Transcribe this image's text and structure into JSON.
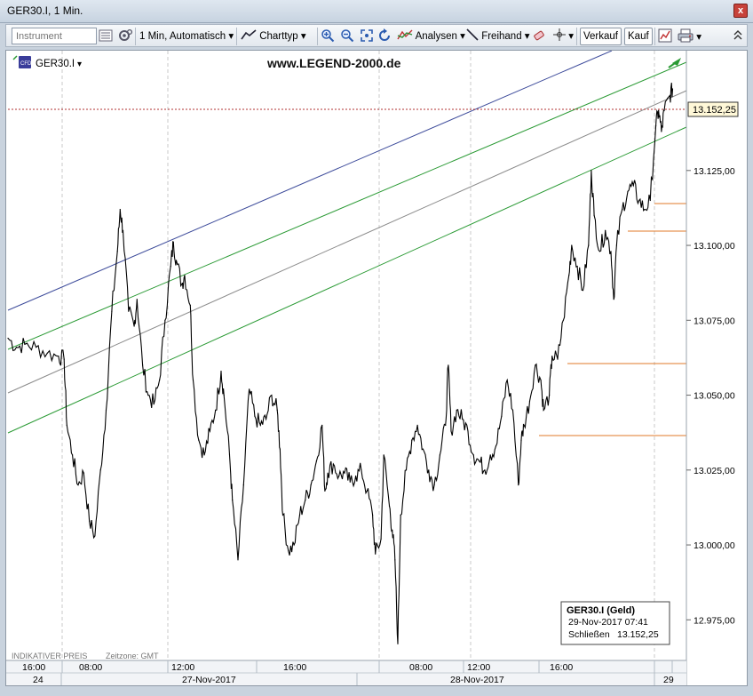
{
  "window": {
    "title": "GER30.I, 1 Min.",
    "close_label": "x"
  },
  "toolbar": {
    "instrument_placeholder": "Instrument",
    "interval": "1 Min,",
    "mode": "Automatisch",
    "charttype": "Charttyp",
    "analysen": "Analysen",
    "freihand": "Freihand",
    "verkauf": "Verkauf",
    "kauf": "Kauf",
    "dropdown_glyph": "▾"
  },
  "chart": {
    "symbol": "GER30.I",
    "watermark": "www.LEGEND-2000.de",
    "footer_left": "INDIKATIVER PREIS",
    "footer_tz": "Zeitzone: GMT",
    "current_price": "13.152,25",
    "y_ticks": [
      "13.125,00",
      "13.100,00",
      "13.075,00",
      "13.050,00",
      "13.025,00",
      "13.000,00",
      "12.975,00"
    ],
    "x_ticks": [
      "16:00",
      "08:00",
      "12:00",
      "16:00",
      "08:00",
      "12:00",
      "16:00"
    ],
    "date_labels": [
      "24",
      "27-Nov-2017",
      "28-Nov-2017",
      "29"
    ],
    "infobox": {
      "title": "GER30.I (Geld)",
      "datetime": "29-Nov-2017 07:41",
      "label": "Schließen",
      "value": "13.152,25"
    },
    "colors": {
      "price": "#000000",
      "channel_upper": "#3c4a9a",
      "channel_green": "#2a9a34",
      "channel_mid": "#8a8a8a",
      "support": "#e07a2a",
      "price_line": "#b03030"
    }
  },
  "chart_data": {
    "type": "line",
    "title": "GER30.I, 1 Min.",
    "series": [
      {
        "name": "GER30.I",
        "points": [
          [
            0,
            13069
          ],
          [
            3,
            13066
          ],
          [
            6,
            13067
          ],
          [
            10,
            13066
          ],
          [
            14,
            13064
          ],
          [
            18,
            13063
          ],
          [
            20,
            13062
          ],
          [
            21,
            13040
          ],
          [
            23,
            13030
          ],
          [
            25,
            13020
          ],
          [
            27,
            13024
          ],
          [
            29,
            13008
          ],
          [
            31,
            13003
          ],
          [
            33,
            13025
          ],
          [
            35,
            13045
          ],
          [
            37,
            13078
          ],
          [
            39,
            13098
          ],
          [
            40,
            13112
          ],
          [
            41,
            13105
          ],
          [
            43,
            13078
          ],
          [
            45,
            13073
          ],
          [
            46,
            13082
          ],
          [
            48,
            13060
          ],
          [
            50,
            13050
          ],
          [
            52,
            13047
          ],
          [
            54,
            13055
          ],
          [
            56,
            13075
          ],
          [
            58,
            13093
          ],
          [
            59,
            13101
          ],
          [
            60,
            13095
          ],
          [
            62,
            13087
          ],
          [
            63,
            13090
          ],
          [
            65,
            13080
          ],
          [
            66,
            13055
          ],
          [
            68,
            13035
          ],
          [
            70,
            13030
          ],
          [
            72,
            13038
          ],
          [
            74,
            13045
          ],
          [
            76,
            13058
          ],
          [
            77,
            13050
          ],
          [
            79,
            13030
          ],
          [
            80,
            13015
          ],
          [
            82,
            12995
          ],
          [
            84,
            13020
          ],
          [
            86,
            13052
          ],
          [
            88,
            13043
          ],
          [
            90,
            13040
          ],
          [
            92,
            13042
          ],
          [
            94,
            13050
          ],
          [
            96,
            13045
          ],
          [
            97,
            13032
          ],
          [
            98,
            13010
          ],
          [
            100,
            12998
          ],
          [
            102,
            13000
          ],
          [
            104,
            13010
          ],
          [
            106,
            13015
          ],
          [
            108,
            13020
          ],
          [
            110,
            13028
          ],
          [
            112,
            13040
          ],
          [
            113,
            13018
          ],
          [
            114,
            13024
          ],
          [
            116,
            13027
          ],
          [
            118,
            13023
          ],
          [
            120,
            13024
          ],
          [
            122,
            13021
          ],
          [
            124,
            13023
          ],
          [
            126,
            13025
          ],
          [
            128,
            13018
          ],
          [
            130,
            13010
          ],
          [
            131,
            12997
          ],
          [
            133,
            13002
          ],
          [
            134,
            13030
          ],
          [
            136,
            13013
          ],
          [
            137,
            13005
          ],
          [
            138,
            12995
          ],
          [
            139,
            12967
          ],
          [
            140,
            13010
          ],
          [
            142,
            13025
          ],
          [
            144,
            13035
          ],
          [
            146,
            13040
          ],
          [
            148,
            13032
          ],
          [
            150,
            13025
          ],
          [
            152,
            13020
          ],
          [
            154,
            13030
          ],
          [
            156,
            13040
          ],
          [
            157,
            13060
          ],
          [
            158,
            13038
          ],
          [
            160,
            13045
          ],
          [
            162,
            13042
          ],
          [
            164,
            13038
          ],
          [
            166,
            13030
          ],
          [
            168,
            13028
          ],
          [
            170,
            13025
          ],
          [
            172,
            13030
          ],
          [
            174,
            13033
          ],
          [
            176,
            13043
          ],
          [
            178,
            13055
          ],
          [
            180,
            13045
          ],
          [
            182,
            13020
          ],
          [
            183,
            13035
          ],
          [
            184,
            13040
          ],
          [
            186,
            13048
          ],
          [
            188,
            13060
          ],
          [
            190,
            13055
          ],
          [
            191,
            13045
          ],
          [
            193,
            13050
          ],
          [
            194,
            13063
          ],
          [
            196,
            13062
          ],
          [
            198,
            13075
          ],
          [
            200,
            13090
          ],
          [
            201,
            13100
          ],
          [
            203,
            13093
          ],
          [
            205,
            13085
          ],
          [
            207,
            13100
          ],
          [
            208,
            13125
          ],
          [
            209,
            13110
          ],
          [
            211,
            13098
          ],
          [
            213,
            13105
          ],
          [
            215,
            13098
          ],
          [
            216,
            13082
          ],
          [
            217,
            13100
          ],
          [
            219,
            13112
          ],
          [
            221,
            13118
          ],
          [
            223,
            13120
          ],
          [
            225,
            13115
          ],
          [
            227,
            13112
          ],
          [
            229,
            13115
          ],
          [
            231,
            13140
          ],
          [
            232,
            13145
          ],
          [
            233,
            13138
          ],
          [
            234,
            13145
          ],
          [
            236,
            13150
          ],
          [
            237,
            13152.25
          ]
        ]
      }
    ],
    "x_range": [
      0,
      240
    ],
    "ylim": [
      12965,
      13165
    ],
    "y_ticks": [
      12975,
      13000,
      13025,
      13050,
      13075,
      13100,
      13125
    ],
    "x_ticks": [
      "16:00",
      "08:00",
      "12:00",
      "16:00",
      "08:00",
      "12:00",
      "16:00"
    ],
    "last_value": 13152.25,
    "grid": false
  }
}
